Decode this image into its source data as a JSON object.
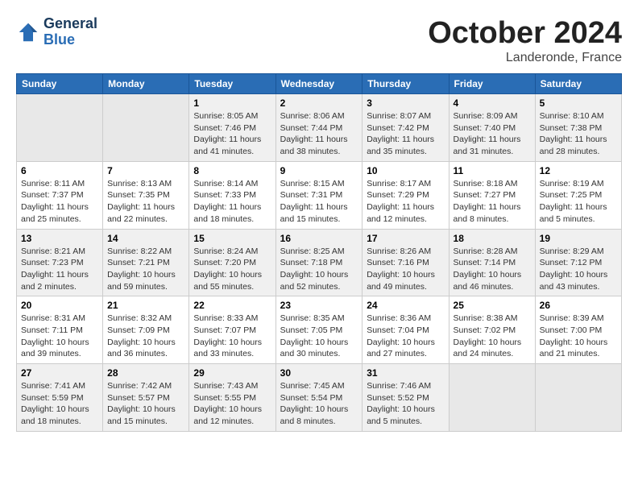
{
  "header": {
    "logo_general": "General",
    "logo_blue": "Blue",
    "month": "October 2024",
    "location": "Landeronde, France"
  },
  "weekdays": [
    "Sunday",
    "Monday",
    "Tuesday",
    "Wednesday",
    "Thursday",
    "Friday",
    "Saturday"
  ],
  "weeks": [
    [
      {
        "day": "",
        "info": ""
      },
      {
        "day": "",
        "info": ""
      },
      {
        "day": "1",
        "info": "Sunrise: 8:05 AM\nSunset: 7:46 PM\nDaylight: 11 hours and 41 minutes."
      },
      {
        "day": "2",
        "info": "Sunrise: 8:06 AM\nSunset: 7:44 PM\nDaylight: 11 hours and 38 minutes."
      },
      {
        "day": "3",
        "info": "Sunrise: 8:07 AM\nSunset: 7:42 PM\nDaylight: 11 hours and 35 minutes."
      },
      {
        "day": "4",
        "info": "Sunrise: 8:09 AM\nSunset: 7:40 PM\nDaylight: 11 hours and 31 minutes."
      },
      {
        "day": "5",
        "info": "Sunrise: 8:10 AM\nSunset: 7:38 PM\nDaylight: 11 hours and 28 minutes."
      }
    ],
    [
      {
        "day": "6",
        "info": "Sunrise: 8:11 AM\nSunset: 7:37 PM\nDaylight: 11 hours and 25 minutes."
      },
      {
        "day": "7",
        "info": "Sunrise: 8:13 AM\nSunset: 7:35 PM\nDaylight: 11 hours and 22 minutes."
      },
      {
        "day": "8",
        "info": "Sunrise: 8:14 AM\nSunset: 7:33 PM\nDaylight: 11 hours and 18 minutes."
      },
      {
        "day": "9",
        "info": "Sunrise: 8:15 AM\nSunset: 7:31 PM\nDaylight: 11 hours and 15 minutes."
      },
      {
        "day": "10",
        "info": "Sunrise: 8:17 AM\nSunset: 7:29 PM\nDaylight: 11 hours and 12 minutes."
      },
      {
        "day": "11",
        "info": "Sunrise: 8:18 AM\nSunset: 7:27 PM\nDaylight: 11 hours and 8 minutes."
      },
      {
        "day": "12",
        "info": "Sunrise: 8:19 AM\nSunset: 7:25 PM\nDaylight: 11 hours and 5 minutes."
      }
    ],
    [
      {
        "day": "13",
        "info": "Sunrise: 8:21 AM\nSunset: 7:23 PM\nDaylight: 11 hours and 2 minutes."
      },
      {
        "day": "14",
        "info": "Sunrise: 8:22 AM\nSunset: 7:21 PM\nDaylight: 10 hours and 59 minutes."
      },
      {
        "day": "15",
        "info": "Sunrise: 8:24 AM\nSunset: 7:20 PM\nDaylight: 10 hours and 55 minutes."
      },
      {
        "day": "16",
        "info": "Sunrise: 8:25 AM\nSunset: 7:18 PM\nDaylight: 10 hours and 52 minutes."
      },
      {
        "day": "17",
        "info": "Sunrise: 8:26 AM\nSunset: 7:16 PM\nDaylight: 10 hours and 49 minutes."
      },
      {
        "day": "18",
        "info": "Sunrise: 8:28 AM\nSunset: 7:14 PM\nDaylight: 10 hours and 46 minutes."
      },
      {
        "day": "19",
        "info": "Sunrise: 8:29 AM\nSunset: 7:12 PM\nDaylight: 10 hours and 43 minutes."
      }
    ],
    [
      {
        "day": "20",
        "info": "Sunrise: 8:31 AM\nSunset: 7:11 PM\nDaylight: 10 hours and 39 minutes."
      },
      {
        "day": "21",
        "info": "Sunrise: 8:32 AM\nSunset: 7:09 PM\nDaylight: 10 hours and 36 minutes."
      },
      {
        "day": "22",
        "info": "Sunrise: 8:33 AM\nSunset: 7:07 PM\nDaylight: 10 hours and 33 minutes."
      },
      {
        "day": "23",
        "info": "Sunrise: 8:35 AM\nSunset: 7:05 PM\nDaylight: 10 hours and 30 minutes."
      },
      {
        "day": "24",
        "info": "Sunrise: 8:36 AM\nSunset: 7:04 PM\nDaylight: 10 hours and 27 minutes."
      },
      {
        "day": "25",
        "info": "Sunrise: 8:38 AM\nSunset: 7:02 PM\nDaylight: 10 hours and 24 minutes."
      },
      {
        "day": "26",
        "info": "Sunrise: 8:39 AM\nSunset: 7:00 PM\nDaylight: 10 hours and 21 minutes."
      }
    ],
    [
      {
        "day": "27",
        "info": "Sunrise: 7:41 AM\nSunset: 5:59 PM\nDaylight: 10 hours and 18 minutes."
      },
      {
        "day": "28",
        "info": "Sunrise: 7:42 AM\nSunset: 5:57 PM\nDaylight: 10 hours and 15 minutes."
      },
      {
        "day": "29",
        "info": "Sunrise: 7:43 AM\nSunset: 5:55 PM\nDaylight: 10 hours and 12 minutes."
      },
      {
        "day": "30",
        "info": "Sunrise: 7:45 AM\nSunset: 5:54 PM\nDaylight: 10 hours and 8 minutes."
      },
      {
        "day": "31",
        "info": "Sunrise: 7:46 AM\nSunset: 5:52 PM\nDaylight: 10 hours and 5 minutes."
      },
      {
        "day": "",
        "info": ""
      },
      {
        "day": "",
        "info": ""
      }
    ]
  ]
}
